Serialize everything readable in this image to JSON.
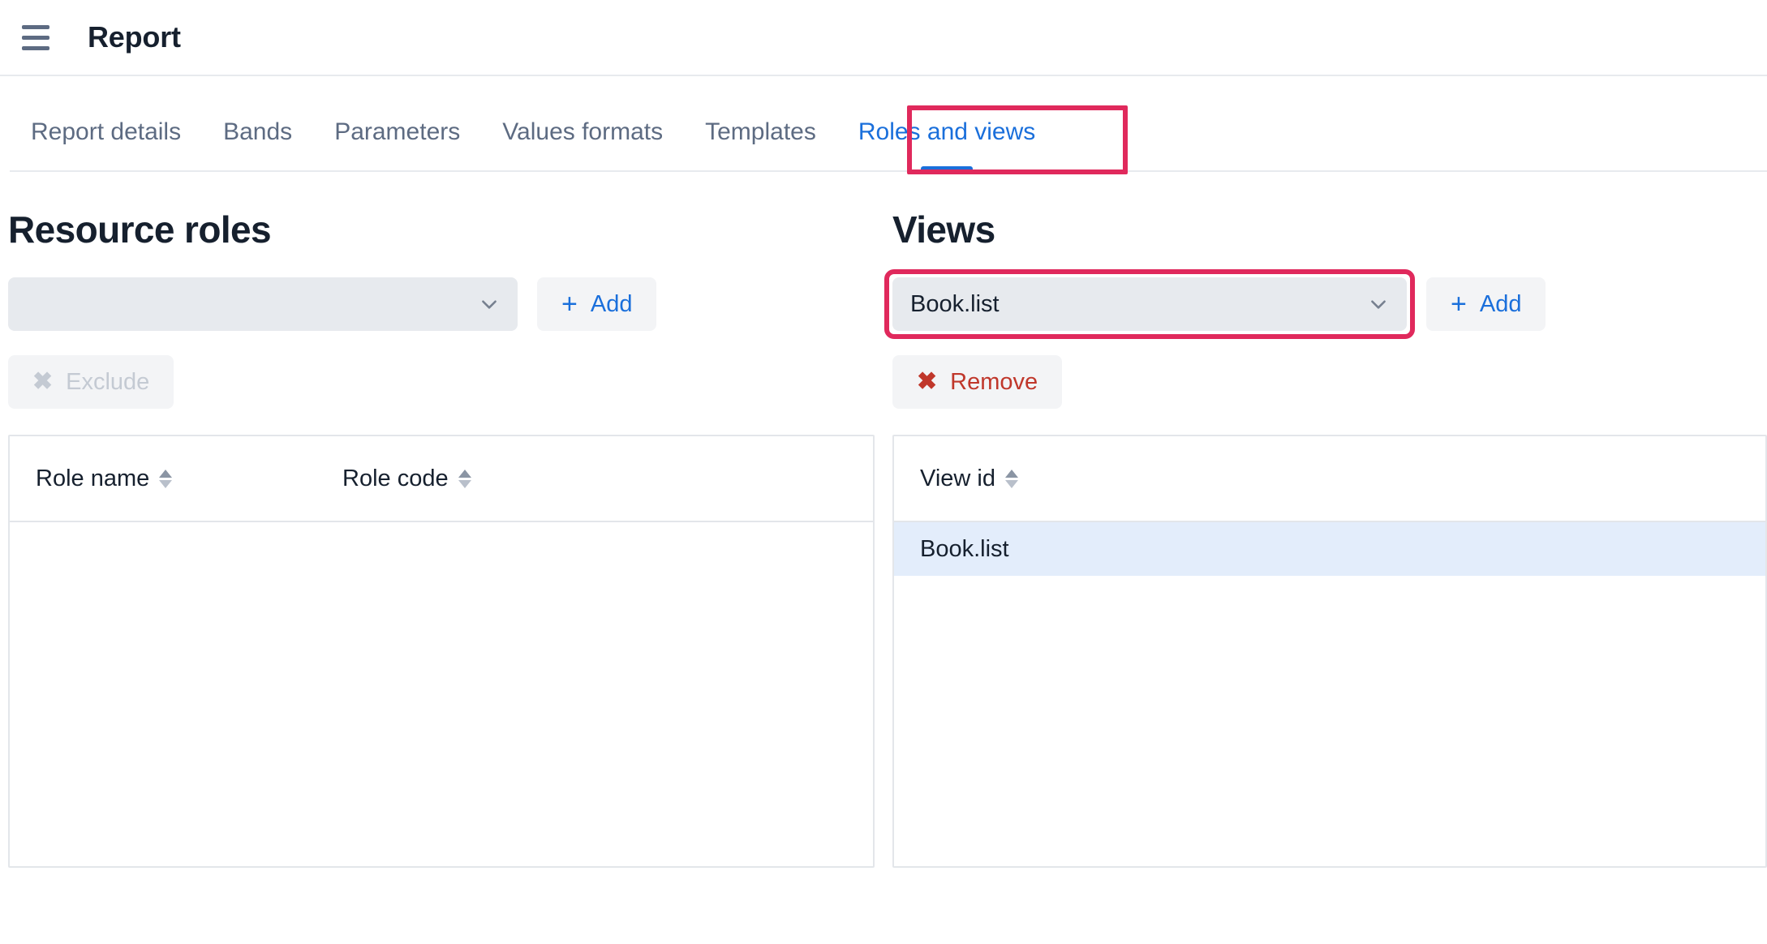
{
  "header": {
    "menu_icon": "hamburger-icon",
    "title": "Report"
  },
  "tabs": [
    {
      "label": "Report details",
      "active": false
    },
    {
      "label": "Bands",
      "active": false
    },
    {
      "label": "Parameters",
      "active": false
    },
    {
      "label": "Values formats",
      "active": false
    },
    {
      "label": "Templates",
      "active": false
    },
    {
      "label": "Roles and views",
      "active": true
    }
  ],
  "resource_roles": {
    "title": "Resource roles",
    "select": {
      "value": "",
      "placeholder": ""
    },
    "add_label": "Add",
    "add_icon": "plus-icon",
    "exclude_label": "Exclude",
    "exclude_icon": "close-x-icon",
    "exclude_disabled": true,
    "table": {
      "columns": [
        "Role name",
        "Role code"
      ],
      "rows": []
    }
  },
  "views": {
    "title": "Views",
    "select": {
      "value": "Book.list"
    },
    "add_label": "Add",
    "add_icon": "plus-icon",
    "remove_label": "Remove",
    "remove_icon": "close-x-icon",
    "table": {
      "columns": [
        "View id"
      ],
      "rows": [
        {
          "view_id": "Book.list",
          "selected": true
        }
      ]
    }
  },
  "annotations": {
    "highlight_color": "#e0295c",
    "targets": [
      "tab-roles-and-views",
      "views-select"
    ]
  },
  "colors": {
    "accent_blue": "#1a6fdb",
    "title_dark": "#16202e",
    "muted": "#5d6b82",
    "danger": "#c0372b",
    "row_selected": "#e3edfb",
    "field_bg": "#e7eaee"
  }
}
